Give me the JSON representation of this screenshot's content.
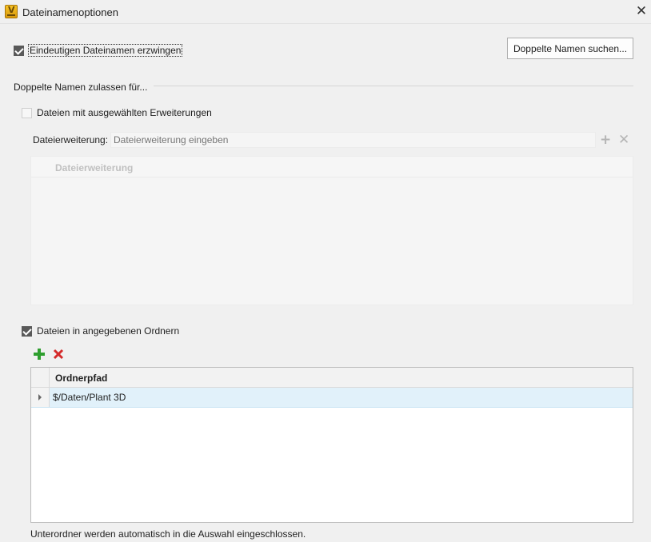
{
  "window": {
    "title": "Dateinamenoptionen",
    "app_icon_letter": "V"
  },
  "enforce_unique": {
    "label": "Eindeutigen Dateinamen erzwingen",
    "checked": true
  },
  "find_duplicates_button": "Doppelte Namen suchen...",
  "allow_duplicates_group": "Doppelte Namen zulassen für...",
  "extensions_option": {
    "label": "Dateien mit ausgewählten Erweiterungen",
    "checked": false,
    "field_label": "Dateierweiterung:",
    "field_placeholder": "Dateierweiterung eingeben",
    "column_header": "Dateierweiterung"
  },
  "folders_option": {
    "label": "Dateien in angegebenen Ordnern",
    "checked": true,
    "column_header": "Ordnerpfad",
    "rows": [
      {
        "path": "$/Daten/Plant 3D"
      }
    ]
  },
  "footer_note": "Unterordner werden automatisch in die Auswahl eingeschlossen.",
  "icons": {
    "add": "plus-icon",
    "remove": "x-icon",
    "close": "close-icon"
  },
  "colors": {
    "add_green": "#2e9e2e",
    "remove_red": "#d42a2a",
    "row_selected": "#e1f1fa"
  }
}
